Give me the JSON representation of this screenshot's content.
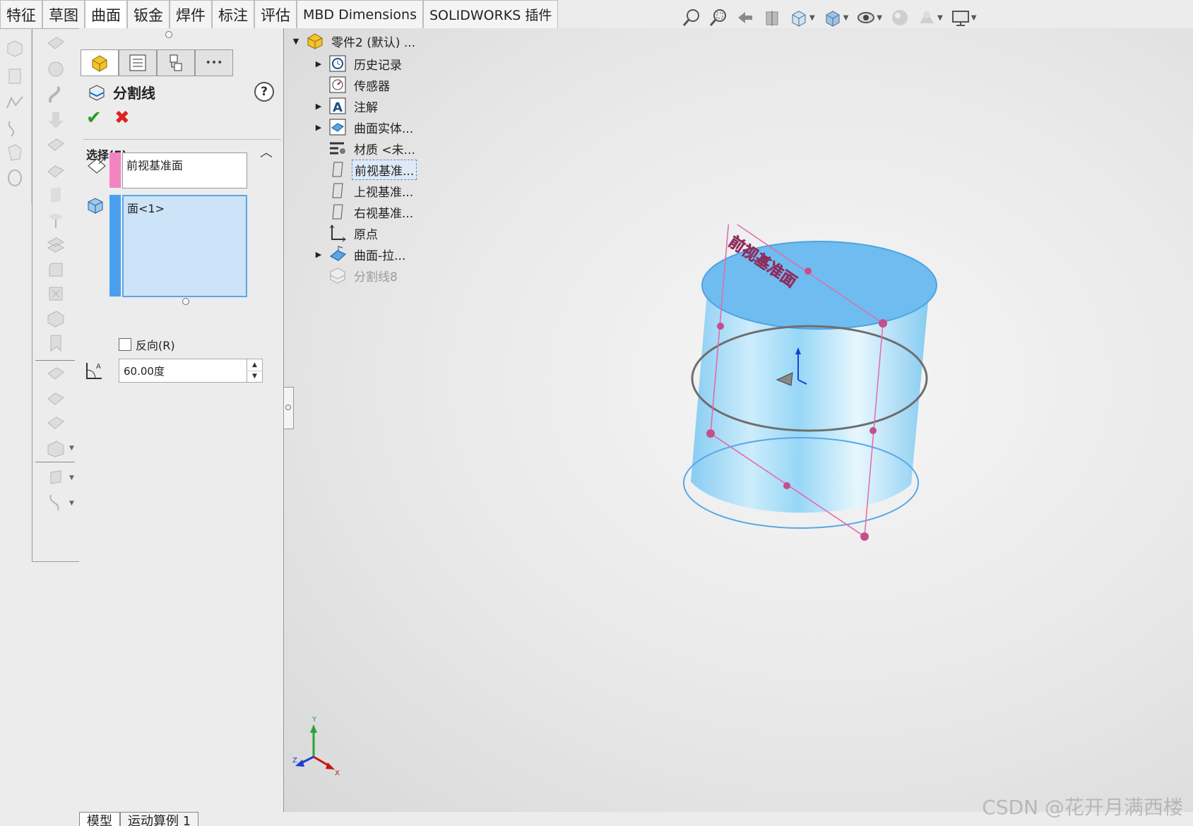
{
  "tabs": [
    "特征",
    "草图",
    "曲面",
    "钣金",
    "焊件",
    "标注",
    "评估",
    "MBD Dimensions",
    "SOLIDWORKS 插件"
  ],
  "active_tab": "曲面",
  "hud_icons": [
    "zoom-to-fit-icon",
    "zoom-to-area-icon",
    "previous-view-icon",
    "section-view-icon",
    "view-orientation-icon",
    "display-style-icon",
    "hide-show-items-icon",
    "edit-appearance-icon",
    "apply-scene-icon",
    "view-settings-icon"
  ],
  "property_manager": {
    "title": "分割线",
    "help": "?",
    "ok": "✔",
    "cancel": "✖",
    "group_title": "选择(E)",
    "plane_selection": "前视基准面",
    "face_selection": "面<1>",
    "reverse_label": "反向(R)",
    "reverse_checked": false,
    "angle_value": "60.00度",
    "more_tab": "•••"
  },
  "feature_tree": {
    "root": "零件2 (默认) ...",
    "items": [
      {
        "label": "历史记录",
        "icon": "history-icon",
        "expandable": true
      },
      {
        "label": "传感器",
        "icon": "sensor-icon",
        "expandable": false
      },
      {
        "label": "注解",
        "icon": "annotation-icon",
        "expandable": true
      },
      {
        "label": "曲面实体...",
        "icon": "surface-bodies-icon",
        "expandable": true
      },
      {
        "label": "材质 <未...",
        "icon": "material-icon",
        "expandable": false
      },
      {
        "label": "前视基准...",
        "icon": "plane-icon",
        "expandable": false,
        "selected": true
      },
      {
        "label": "上视基准...",
        "icon": "plane-icon",
        "expandable": false
      },
      {
        "label": "右视基准...",
        "icon": "plane-icon",
        "expandable": false
      },
      {
        "label": "原点",
        "icon": "origin-icon",
        "expandable": false
      },
      {
        "label": "曲面-拉...",
        "icon": "surface-extrude-icon",
        "expandable": true
      },
      {
        "label": "分割线8",
        "icon": "split-line-icon",
        "expandable": false,
        "greyed": true
      }
    ]
  },
  "viewport": {
    "plane_label": "前视基准面",
    "surface_color": "#8fd4f7",
    "plane_color": "#e36aa8"
  },
  "triad": {
    "x": "X",
    "y": "Y",
    "z": "Z"
  },
  "bottom_tabs": [
    "模型",
    "运动算例 1"
  ],
  "watermark": "CSDN @花开月满西楼"
}
